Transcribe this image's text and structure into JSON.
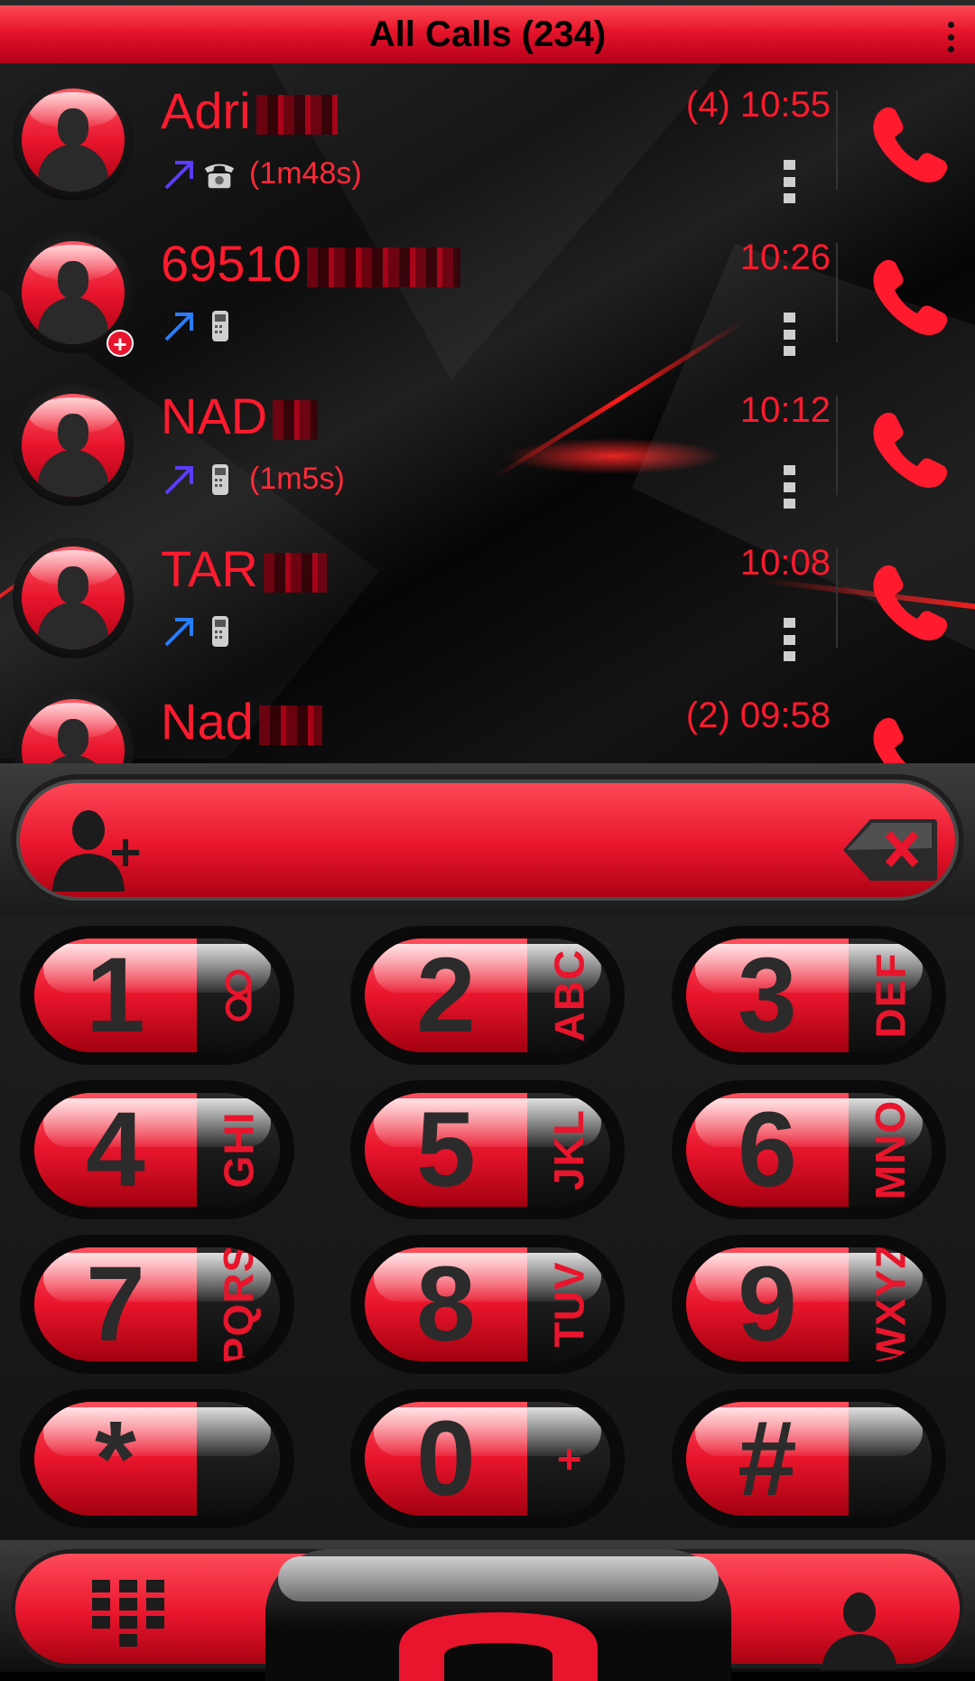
{
  "header": {
    "title": "All Calls (234)"
  },
  "calls": [
    {
      "name": "Adri",
      "time": "(4) 10:55",
      "duration": "(1m48s)",
      "line": "landline",
      "has_add_badge": false
    },
    {
      "name": "69510",
      "time": "10:26",
      "duration": "",
      "line": "mobile",
      "has_add_badge": true
    },
    {
      "name": "NAD",
      "time": "10:12",
      "duration": "(1m5s)",
      "line": "mobile",
      "has_add_badge": false
    },
    {
      "name": "TAR",
      "time": "10:08",
      "duration": "",
      "line": "mobile",
      "has_add_badge": false
    },
    {
      "name": "Nad",
      "time": "(2) 09:58",
      "duration": "",
      "line": "mobile",
      "has_add_badge": false
    }
  ],
  "input": {
    "number": ""
  },
  "keypad": [
    {
      "digit": "1",
      "letters": ""
    },
    {
      "digit": "2",
      "letters": "ABC"
    },
    {
      "digit": "3",
      "letters": "DEF"
    },
    {
      "digit": "4",
      "letters": "GHI"
    },
    {
      "digit": "5",
      "letters": "JKL"
    },
    {
      "digit": "6",
      "letters": "MNO"
    },
    {
      "digit": "7",
      "letters": "PQRS"
    },
    {
      "digit": "8",
      "letters": "TUV"
    },
    {
      "digit": "9",
      "letters": "WXYZ"
    },
    {
      "digit": "*",
      "letters": ""
    },
    {
      "digit": "0",
      "letters": "+"
    },
    {
      "digit": "#",
      "letters": ""
    }
  ],
  "icons": {
    "voicemail": "voicemail-icon",
    "outgoing": "outgoing-call-arrow-icon",
    "add_contact": "add-contact-icon",
    "backspace": "backspace-icon",
    "dialpad": "dialpad-icon",
    "call": "phone-handset-icon",
    "contacts": "contacts-icon"
  },
  "colors": {
    "accent": "#e8152c",
    "text_red": "#ff1a2e",
    "outgoing_arrow_1": "#5a3cff",
    "outgoing_arrow_2": "#2a7dff"
  }
}
